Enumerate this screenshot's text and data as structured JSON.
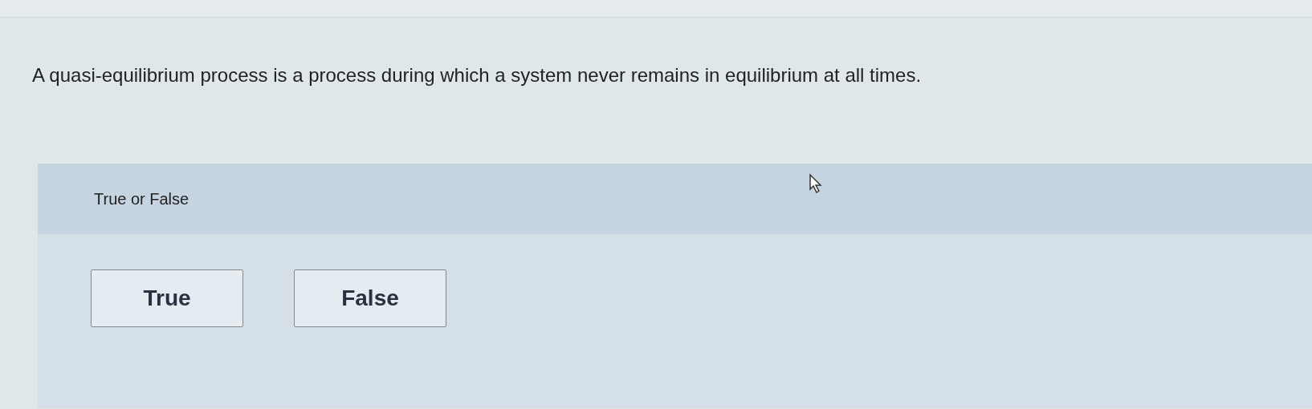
{
  "question": "A quasi-equilibrium process is a process during which a system never remains in equilibrium at all times.",
  "prompt": "True or False",
  "options": [
    {
      "label": "True",
      "selected": false
    },
    {
      "label": "False",
      "selected": false
    }
  ]
}
